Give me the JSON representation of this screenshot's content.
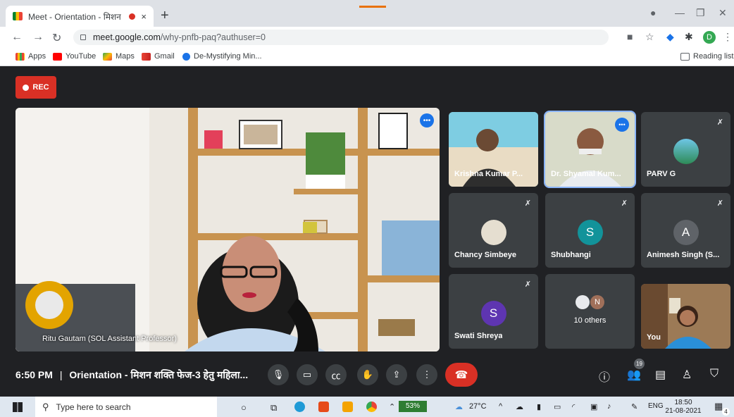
{
  "browser": {
    "tab_title": "Meet - Orientation - मिशन श",
    "tab_close": "×",
    "new_tab": "+",
    "url_host": "meet.google.com",
    "url_path": "/why-pnfb-paq?authuser=0",
    "profile_initial": "D",
    "bookmarks": [
      "Apps",
      "YouTube",
      "Maps",
      "Gmail",
      "De-Mystifying Min..."
    ],
    "reading_list": "Reading list"
  },
  "meet": {
    "rec_label": "REC",
    "main_speaker": "Ritu Gautam (SOL Assistant Professor)",
    "tiles": [
      {
        "name": "Krishna Kumar P...",
        "type": "video",
        "muted": false
      },
      {
        "name": "Dr. Shyamal Kum...",
        "type": "video",
        "muted": false
      },
      {
        "name": "PARV G",
        "type": "avatar-image",
        "muted": true
      },
      {
        "name": "Chancy Simbeye",
        "type": "avatar-image",
        "muted": true
      },
      {
        "name": "Shubhangi",
        "type": "avatar",
        "initial": "S",
        "color": "#12939a",
        "muted": true
      },
      {
        "name": "Animesh Singh (S...",
        "type": "avatar",
        "initial": "A",
        "color": "#5f6368",
        "muted": true
      },
      {
        "name": "Swati Shreya",
        "type": "avatar",
        "initial": "S",
        "color": "#5e35b1",
        "muted": true
      },
      {
        "name": "10 others",
        "type": "others",
        "initial": "N",
        "muted": false
      },
      {
        "name": "You",
        "type": "video",
        "muted": false
      }
    ],
    "time": "6:50 PM",
    "separator": "|",
    "meeting_title": "Orientation - मिशन शक्ति फेज-3 हेतु महिला...",
    "participant_count": "19",
    "colors": {
      "rec": "#d93025",
      "end_call": "#d93025",
      "background": "#202124",
      "tile": "#3c4043"
    }
  },
  "taskbar": {
    "search_placeholder": "Type here to search",
    "battery": "53%",
    "weather": "27°C",
    "language": "ENG",
    "time": "18:50",
    "date": "21-08-2021",
    "notifications": "4"
  }
}
